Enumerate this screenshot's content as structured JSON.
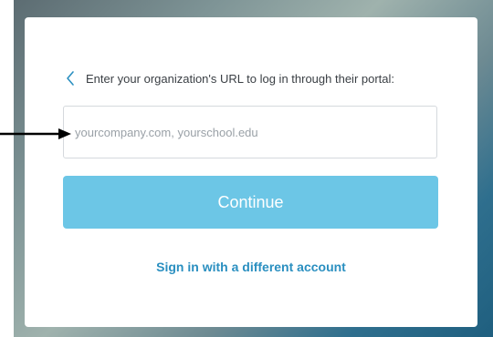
{
  "login": {
    "prompt": "Enter your organization's URL to log in through their portal:",
    "url_input": {
      "placeholder": "yourcompany.com, yourschool.edu",
      "value": ""
    },
    "continue_label": "Continue",
    "alt_signin_label": "Sign in with a different account"
  },
  "icons": {
    "back": "chevron-left-icon",
    "annotation_arrow": "arrow-right-icon"
  },
  "colors": {
    "accent": "#6cc6e6",
    "link": "#2a8fc0",
    "back_chevron": "#2a8fc0"
  }
}
